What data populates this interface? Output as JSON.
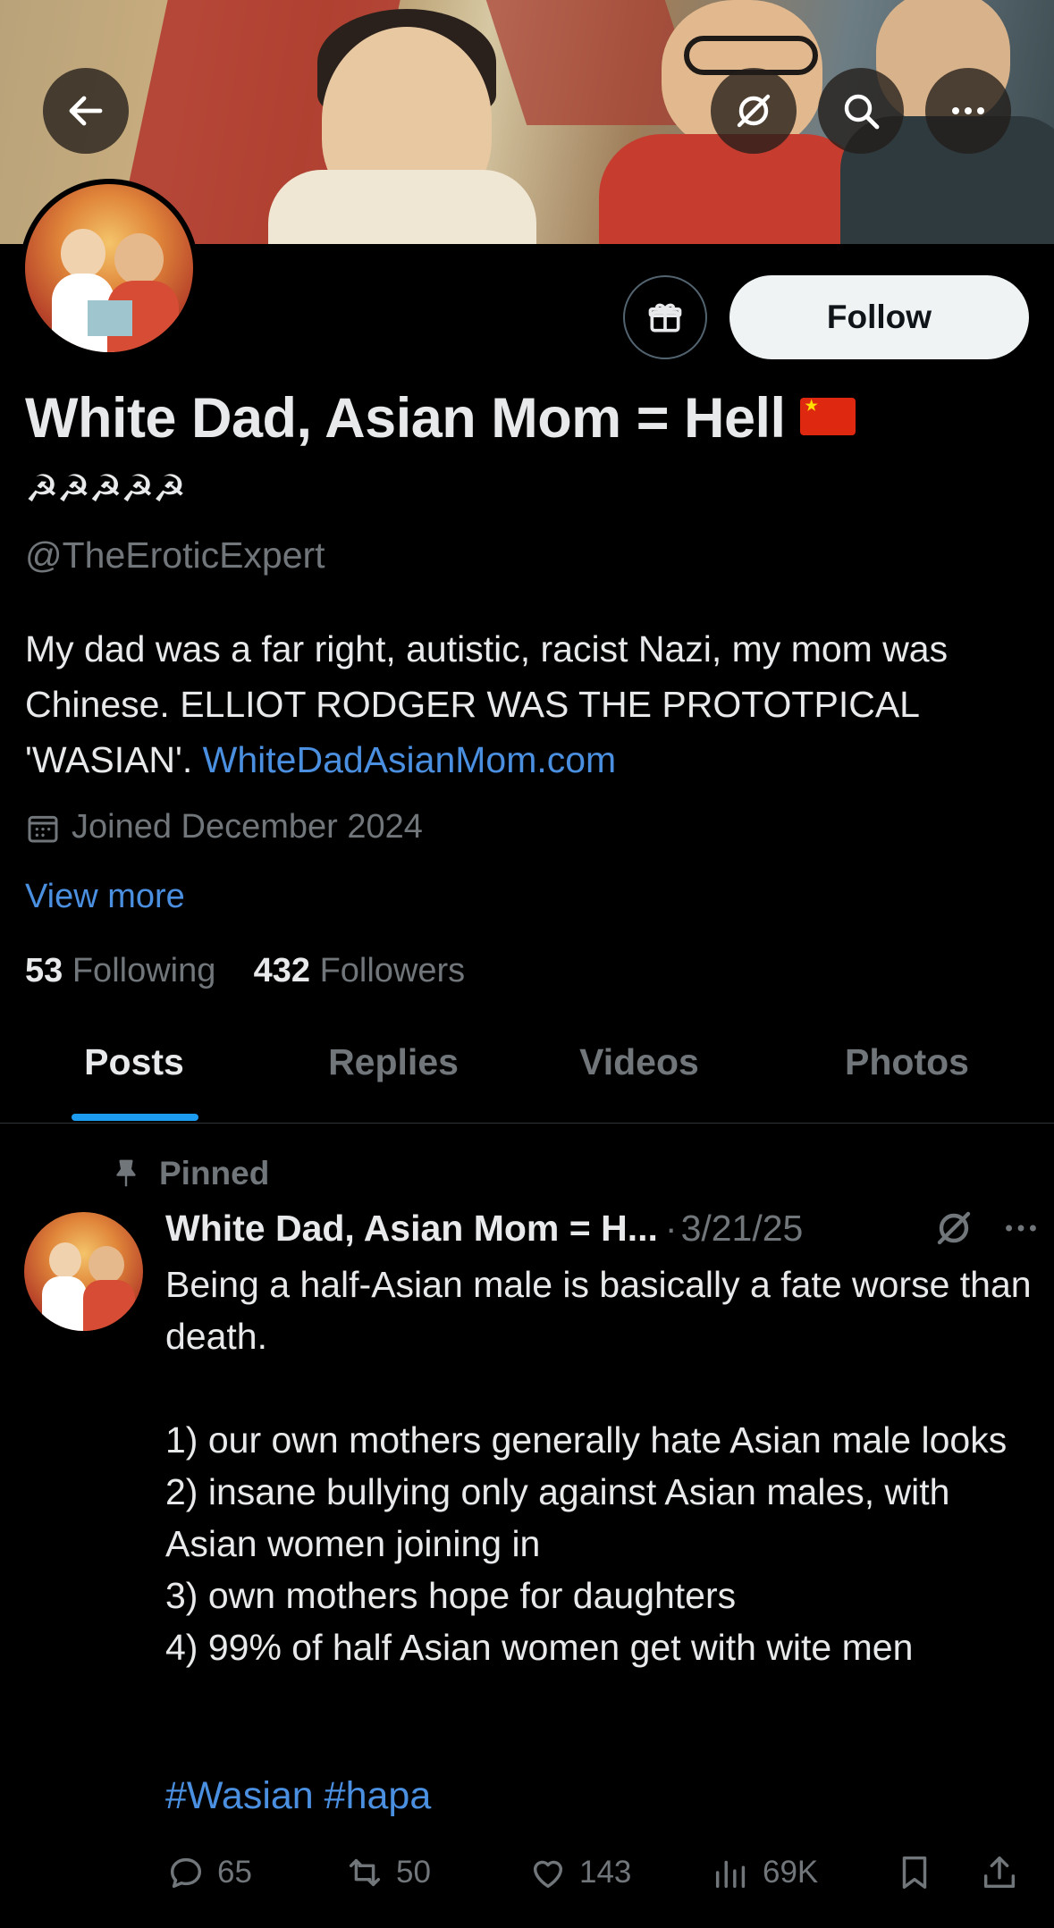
{
  "profile": {
    "display_name": "White Dad, Asian Mom = Hell",
    "name_emoji_row": "☭☭☭☭☭",
    "handle": "@TheEroticExpert",
    "bio_text": "My dad was a far right, autistic, racist Nazi, my mom was Chinese. ELLIOT RODGER WAS THE PROTOTPICAL 'WASIAN'.",
    "bio_link": "WhiteDadAsianMom.com",
    "joined": "Joined December 2024",
    "view_more": "View more",
    "following_count": "53",
    "following_label": "Following",
    "followers_count": "432",
    "followers_label": "Followers",
    "follow_button": "Follow"
  },
  "tabs": [
    "Posts",
    "Replies",
    "Videos",
    "Photos"
  ],
  "active_tab": "Posts",
  "post": {
    "pinned_label": "Pinned",
    "author": "White Dad, Asian Mom = H...",
    "separator": "·",
    "date": "3/21/25",
    "text": "Being a half-Asian male is basically a fate worse than death.\n\n1) our own mothers generally hate Asian male looks\n2) insane bullying only against Asian males, with Asian women joining in\n3) own mothers hope for daughters\n4) 99% of half Asian women get with wite men",
    "hashtags": [
      "#Wasian",
      "#hapa"
    ],
    "replies": "65",
    "reposts": "50",
    "likes": "143",
    "views": "69K"
  },
  "icons": [
    "back-arrow-icon",
    "grok-slash-icon",
    "search-icon",
    "more-icon",
    "gift-icon",
    "calendar-icon",
    "pin-icon",
    "reply-icon",
    "repost-icon",
    "like-icon",
    "views-icon",
    "bookmark-icon",
    "share-icon"
  ],
  "colors": {
    "background": "#000000",
    "link": "#4a8fe0",
    "tab_indicator": "#1d9bf0",
    "muted": "#71767b",
    "follow_bg": "#eff3f4"
  }
}
